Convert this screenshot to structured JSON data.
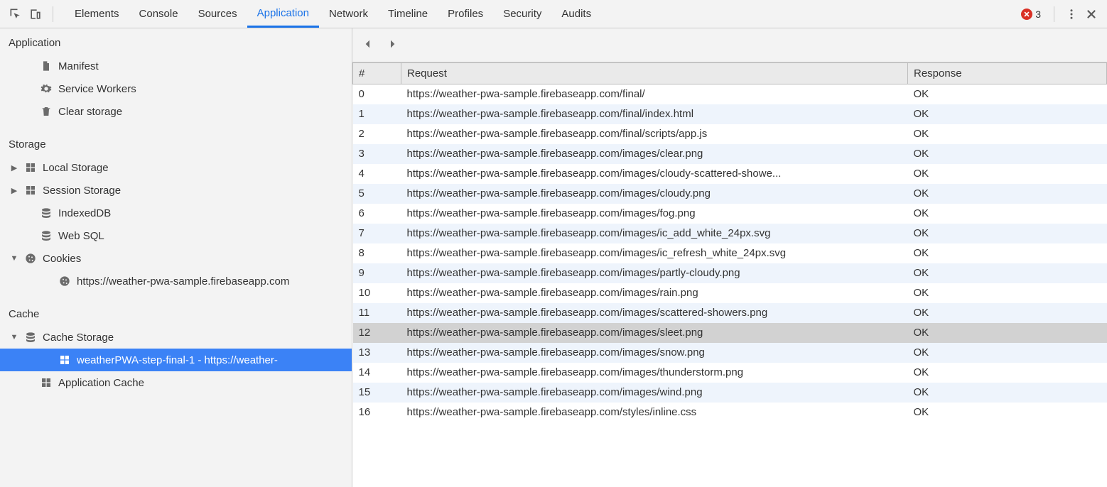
{
  "tabs": [
    "Elements",
    "Console",
    "Sources",
    "Application",
    "Network",
    "Timeline",
    "Profiles",
    "Security",
    "Audits"
  ],
  "active_tab": "Application",
  "error_count": "3",
  "sidebar": {
    "groups": [
      {
        "title": "Application",
        "items": [
          {
            "label": "Manifest",
            "icon": "file",
            "depth": 1
          },
          {
            "label": "Service Workers",
            "icon": "gear",
            "depth": 1
          },
          {
            "label": "Clear storage",
            "icon": "trash",
            "depth": 1
          }
        ]
      },
      {
        "title": "Storage",
        "items": [
          {
            "label": "Local Storage",
            "icon": "grid",
            "depth": 0,
            "expandable": true,
            "arrow": "right"
          },
          {
            "label": "Session Storage",
            "icon": "grid",
            "depth": 0,
            "expandable": true,
            "arrow": "right"
          },
          {
            "label": "IndexedDB",
            "icon": "db",
            "depth": 1
          },
          {
            "label": "Web SQL",
            "icon": "db",
            "depth": 1
          },
          {
            "label": "Cookies",
            "icon": "cookie",
            "depth": 0,
            "expandable": true,
            "arrow": "down"
          },
          {
            "label": "https://weather-pwa-sample.firebaseapp.com",
            "icon": "cookie",
            "depth": 2
          }
        ]
      },
      {
        "title": "Cache",
        "items": [
          {
            "label": "Cache Storage",
            "icon": "db",
            "depth": 0,
            "expandable": true,
            "arrow": "down"
          },
          {
            "label": "weatherPWA-step-final-1 - https://weather-",
            "icon": "grid",
            "depth": 2,
            "selected": true
          },
          {
            "label": "Application Cache",
            "icon": "grid",
            "depth": 1
          }
        ]
      }
    ]
  },
  "table": {
    "headers": [
      "#",
      "Request",
      "Response"
    ],
    "rows": [
      {
        "n": "0",
        "req": "https://weather-pwa-sample.firebaseapp.com/final/",
        "resp": "OK"
      },
      {
        "n": "1",
        "req": "https://weather-pwa-sample.firebaseapp.com/final/index.html",
        "resp": "OK"
      },
      {
        "n": "2",
        "req": "https://weather-pwa-sample.firebaseapp.com/final/scripts/app.js",
        "resp": "OK"
      },
      {
        "n": "3",
        "req": "https://weather-pwa-sample.firebaseapp.com/images/clear.png",
        "resp": "OK"
      },
      {
        "n": "4",
        "req": "https://weather-pwa-sample.firebaseapp.com/images/cloudy-scattered-showe...",
        "resp": "OK"
      },
      {
        "n": "5",
        "req": "https://weather-pwa-sample.firebaseapp.com/images/cloudy.png",
        "resp": "OK"
      },
      {
        "n": "6",
        "req": "https://weather-pwa-sample.firebaseapp.com/images/fog.png",
        "resp": "OK"
      },
      {
        "n": "7",
        "req": "https://weather-pwa-sample.firebaseapp.com/images/ic_add_white_24px.svg",
        "resp": "OK"
      },
      {
        "n": "8",
        "req": "https://weather-pwa-sample.firebaseapp.com/images/ic_refresh_white_24px.svg",
        "resp": "OK"
      },
      {
        "n": "9",
        "req": "https://weather-pwa-sample.firebaseapp.com/images/partly-cloudy.png",
        "resp": "OK"
      },
      {
        "n": "10",
        "req": "https://weather-pwa-sample.firebaseapp.com/images/rain.png",
        "resp": "OK"
      },
      {
        "n": "11",
        "req": "https://weather-pwa-sample.firebaseapp.com/images/scattered-showers.png",
        "resp": "OK"
      },
      {
        "n": "12",
        "req": "https://weather-pwa-sample.firebaseapp.com/images/sleet.png",
        "resp": "OK",
        "selected": true
      },
      {
        "n": "13",
        "req": "https://weather-pwa-sample.firebaseapp.com/images/snow.png",
        "resp": "OK"
      },
      {
        "n": "14",
        "req": "https://weather-pwa-sample.firebaseapp.com/images/thunderstorm.png",
        "resp": "OK"
      },
      {
        "n": "15",
        "req": "https://weather-pwa-sample.firebaseapp.com/images/wind.png",
        "resp": "OK"
      },
      {
        "n": "16",
        "req": "https://weather-pwa-sample.firebaseapp.com/styles/inline.css",
        "resp": "OK"
      }
    ]
  }
}
